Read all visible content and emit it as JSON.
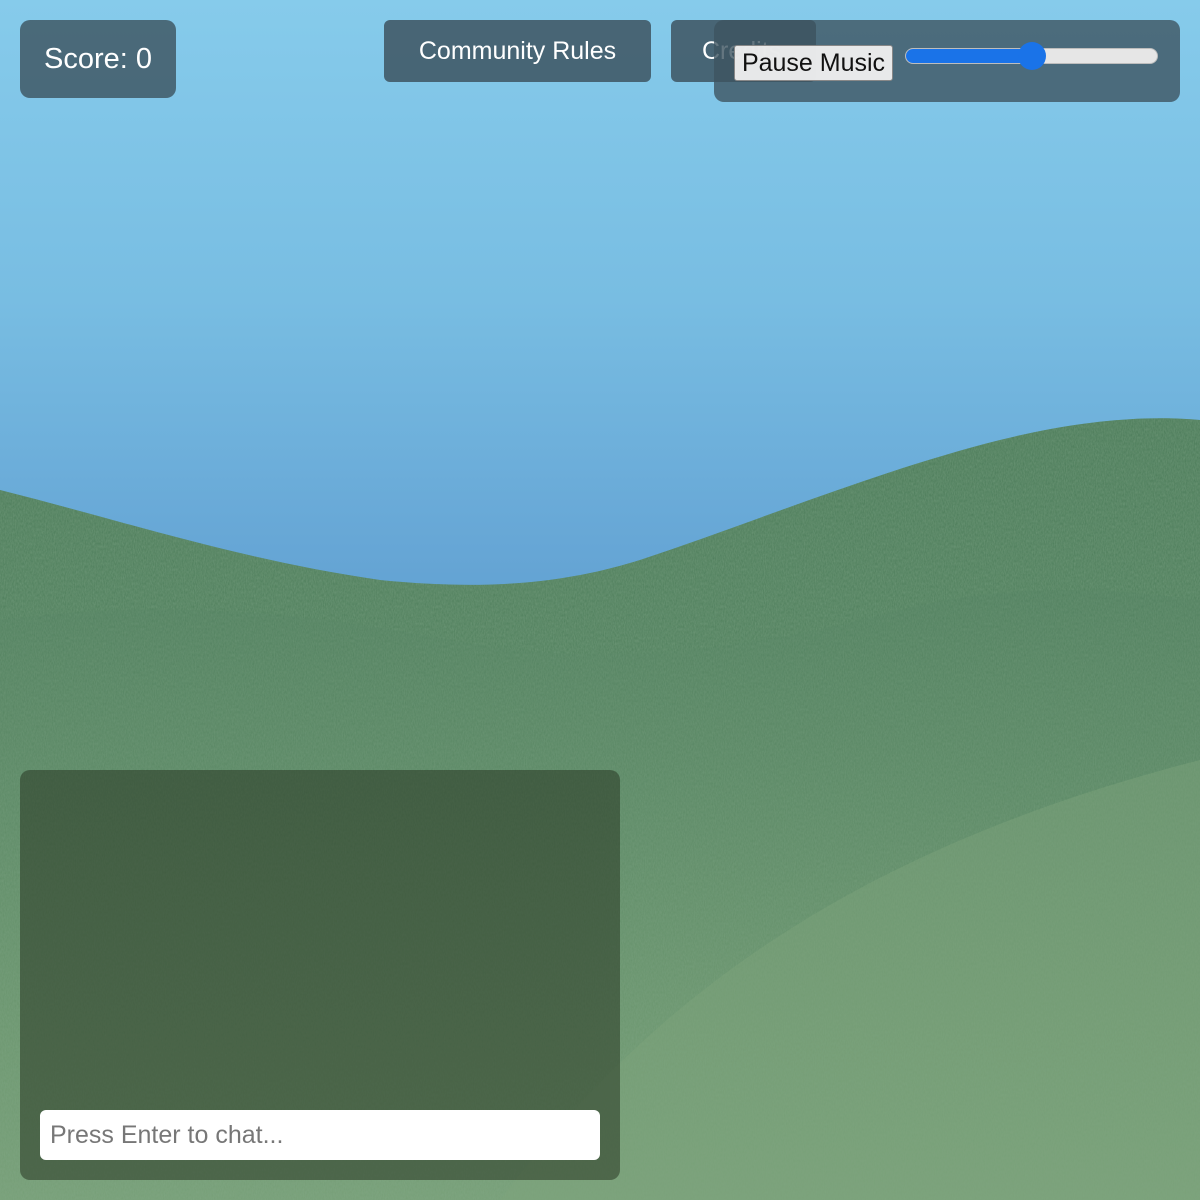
{
  "hud": {
    "score_text": "Score: 0",
    "community_rules_label": "Community Rules",
    "credits_label": "Credits",
    "pause_music_label": "Pause Music",
    "volume_fraction": 0.5
  },
  "chat": {
    "placeholder": "Press Enter to chat...",
    "value": ""
  },
  "colors": {
    "sky_top": "#86cbeb",
    "sky_horizon": "#5a98cb",
    "grass_far": "#4e7f5c",
    "grass_near": "#6f9a72",
    "hud_panel": "#3d5460",
    "slider_accent": "#1a73e8"
  }
}
